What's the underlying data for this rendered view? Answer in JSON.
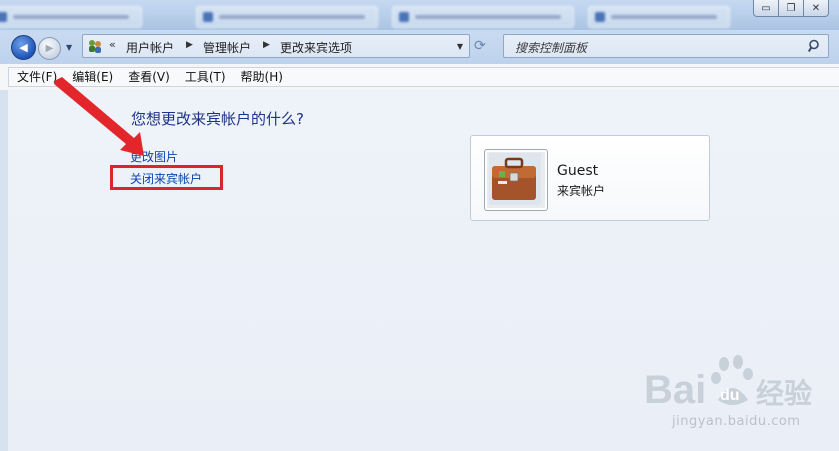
{
  "window": {
    "buttons": [
      {
        "name": "monitor",
        "glyph": "▭"
      },
      {
        "name": "restore",
        "glyph": "❐"
      },
      {
        "name": "close",
        "glyph": "✕"
      }
    ]
  },
  "nav": {
    "back_glyph": "◀",
    "forward_glyph": "▶",
    "history_glyph": "▼",
    "address_chevron": "«",
    "breadcrumbs": [
      "用户帐户",
      "管理帐户",
      "更改来宾选项"
    ],
    "crumb_separator": "▶",
    "dropdown_glyph": "▼",
    "refresh_glyph": "⟳",
    "search_placeholder": "搜索控制面板"
  },
  "menu": {
    "items": [
      "文件(F)",
      "编辑(E)",
      "查看(V)",
      "工具(T)",
      "帮助(H)"
    ]
  },
  "main": {
    "question": "您想更改来宾帐户的什么?",
    "links": {
      "change_picture": "更改图片",
      "turn_off_guest": "关闭来宾帐户"
    },
    "account": {
      "name": "Guest",
      "type": "来宾帐户"
    }
  },
  "watermark": {
    "logo_text": "Bai",
    "logo_text2": "du",
    "logo_suffix": "经验",
    "url": "jingyan.baidu.com"
  },
  "colors": {
    "link": "#0645ad",
    "question": "#1e3287",
    "highlight": "#d8262b"
  }
}
